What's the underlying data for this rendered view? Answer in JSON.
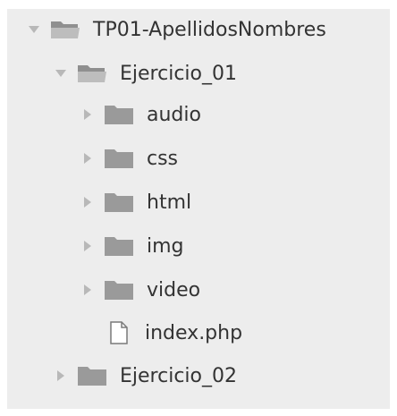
{
  "tree": {
    "root": {
      "label": "TP01-ApellidosNombres",
      "expanded": true,
      "icon": "folder-open-icon"
    },
    "ejercicio_01": {
      "label": "Ejercicio_01",
      "expanded": true,
      "icon": "folder-open-icon",
      "children": [
        {
          "label": "audio",
          "icon": "folder-icon",
          "expanded": false
        },
        {
          "label": "css",
          "icon": "folder-icon",
          "expanded": false
        },
        {
          "label": "html",
          "icon": "folder-icon",
          "expanded": false
        },
        {
          "label": "img",
          "icon": "folder-icon",
          "expanded": false
        },
        {
          "label": "video",
          "icon": "folder-icon",
          "expanded": false
        },
        {
          "label": "index.php",
          "icon": "file-icon"
        }
      ]
    },
    "ejercicio_02": {
      "label": "Ejercicio_02",
      "expanded": false,
      "icon": "folder-icon"
    }
  },
  "colors": {
    "panel_background": "#ededed",
    "text": "#333333",
    "folder_fill": "#9a9a9a",
    "arrow": "#b8b8b8"
  }
}
